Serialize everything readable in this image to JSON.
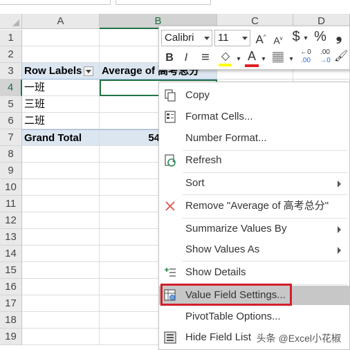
{
  "columns": [
    "A",
    "B",
    "C",
    "D"
  ],
  "rows": [
    "1",
    "2",
    "3",
    "4",
    "5",
    "6",
    "7",
    "8",
    "9",
    "10",
    "11",
    "12",
    "13",
    "14",
    "15",
    "16",
    "17",
    "18",
    "19"
  ],
  "pivot": {
    "row_labels_header": "Row Labels",
    "value_header": "Average of 高考总分",
    "items": [
      "一班",
      "三班",
      "二班"
    ],
    "grand_total_label": "Grand Total",
    "grand_total_value": "54"
  },
  "mini_toolbar": {
    "font_name": "Calibri",
    "font_size": "11",
    "grow_font": "A",
    "shrink_font": "A",
    "currency": "$",
    "percent": "%",
    "comma": "❟",
    "bold": "B",
    "italic": "I",
    "align": "≡",
    "fill_letter": "◇",
    "font_color_letter": "A",
    "border": "▦",
    "inc_decimal_top": "←0",
    "inc_decimal_bottom": ".00",
    "dec_decimal_top": ".00",
    "dec_decimal_bottom": "→0",
    "format_painter": "🖌",
    "accent_red": "#e02020",
    "fill_yellow": "#ffff00"
  },
  "context_menu": {
    "items": [
      {
        "label": "Copy",
        "icon": "copy-icon",
        "submenu": false
      },
      {
        "label": "Format Cells...",
        "icon": "format-cells-icon",
        "submenu": false
      },
      {
        "label": "Number Format...",
        "icon": "",
        "submenu": false
      },
      {
        "label": "Refresh",
        "icon": "refresh-icon",
        "submenu": false
      },
      {
        "label": "Sort",
        "icon": "",
        "submenu": true
      },
      {
        "label": "Remove \"Average of 高考总分\"",
        "icon": "remove-x-icon",
        "submenu": false
      },
      {
        "label": "Summarize Values By",
        "icon": "",
        "submenu": true
      },
      {
        "label": "Show Values As",
        "icon": "",
        "submenu": true
      },
      {
        "label": "Show Details",
        "icon": "show-details-icon",
        "submenu": false
      },
      {
        "label": "Value Field Settings...",
        "icon": "value-field-settings-icon",
        "submenu": false
      },
      {
        "label": "PivotTable Options...",
        "icon": "",
        "submenu": false
      },
      {
        "label": "Hide Field List",
        "icon": "field-list-icon",
        "submenu": false
      }
    ],
    "highlight_color": "#c7c7c7",
    "callout_color": "#d21f2b"
  },
  "watermark": "头条 @Excel小花椒",
  "colors": {
    "pivot_header_bg": "#dce6f1",
    "selection_green": "#217346",
    "header_bg": "#e9e9e9"
  }
}
